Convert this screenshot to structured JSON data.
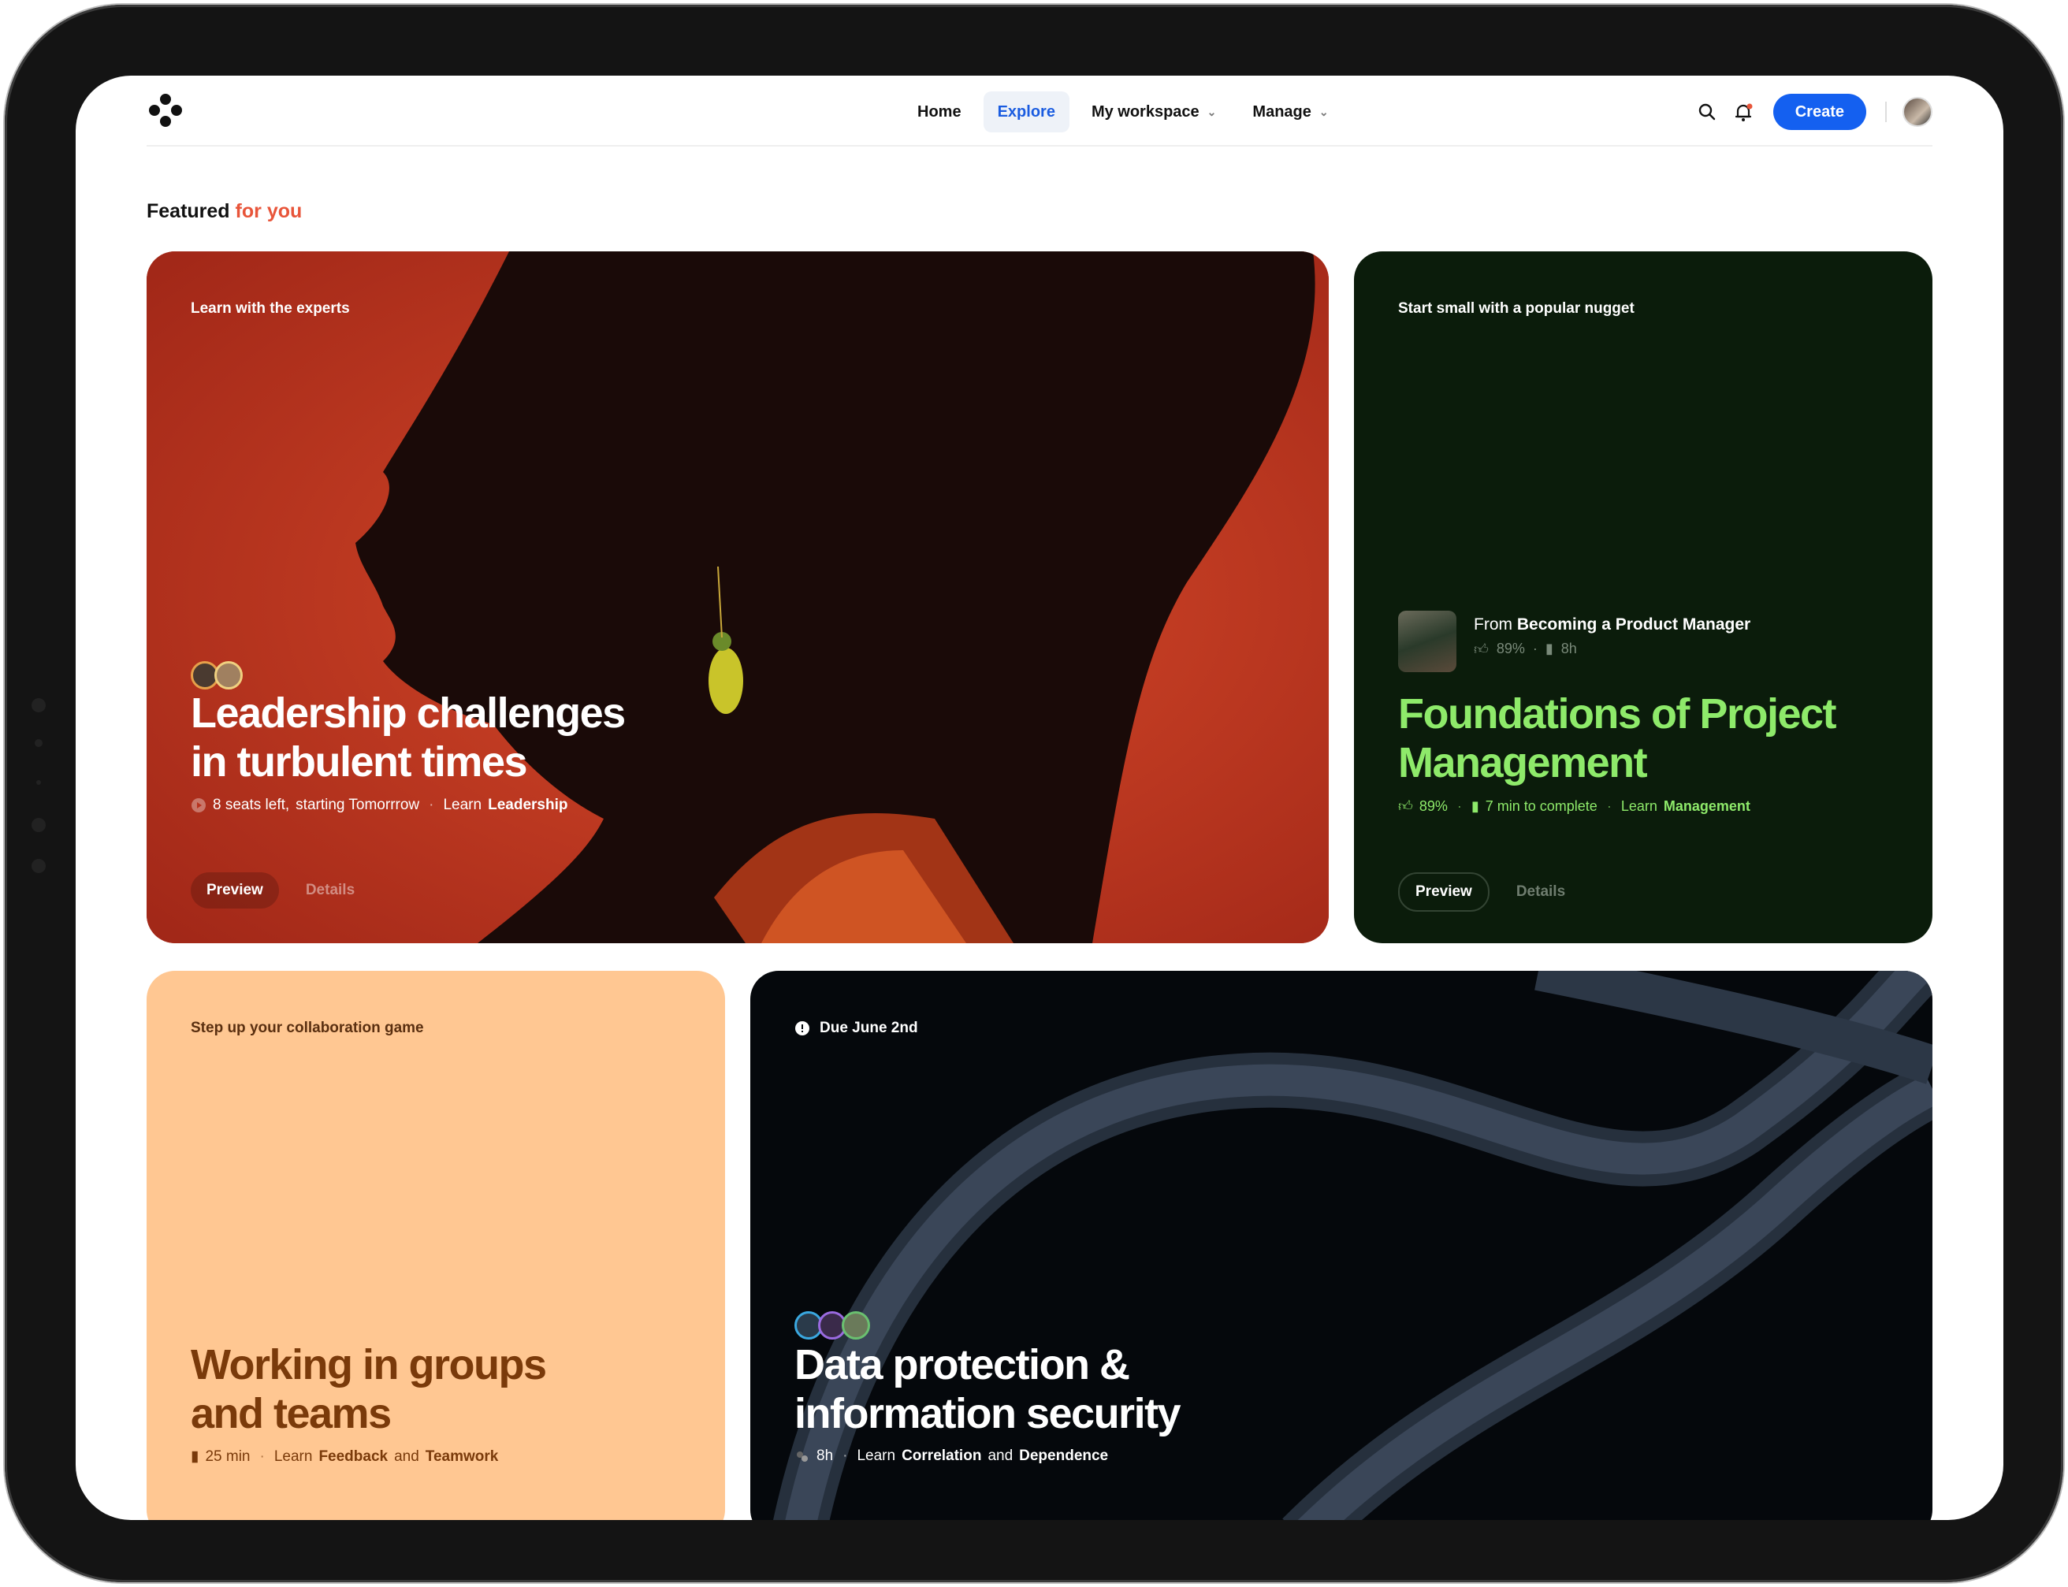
{
  "nav": {
    "items": [
      {
        "label": "Home",
        "active": false,
        "has_menu": false
      },
      {
        "label": "Explore",
        "active": true,
        "has_menu": false
      },
      {
        "label": "My workspace",
        "active": false,
        "has_menu": true
      },
      {
        "label": "Manage",
        "active": false,
        "has_menu": true
      }
    ],
    "create_label": "Create",
    "icons": [
      "search-icon",
      "bell-icon"
    ],
    "accent_color": "#1460f0"
  },
  "section": {
    "title_main": "Featured",
    "title_accent": "for you",
    "accent_color": "#e8553a"
  },
  "cards": {
    "leadership": {
      "eyebrow": "Learn with the experts",
      "title_line1": "Leadership challenges",
      "title_line2": "in turbulent times",
      "seats": "8 seats left,",
      "start": "starting Tomorrrow",
      "learn_prefix": "Learn",
      "topic": "Leadership",
      "preview": "Preview",
      "details": "Details",
      "bg_color": "#b8321e"
    },
    "project": {
      "eyebrow": "Start small with a popular nugget",
      "from_prefix": "From",
      "from_course": "Becoming a Product Manager",
      "from_rating": "89%",
      "from_sep": "·",
      "from_duration": "8h",
      "title_line1": "Foundations of Project",
      "title_line2": "Management",
      "rating": "89%",
      "duration": "7 min to complete",
      "learn_prefix": "Learn",
      "topic": "Management",
      "preview": "Preview",
      "details": "Details",
      "accent_color": "#8eea6a"
    },
    "groups": {
      "eyebrow": "Step up your collaboration game",
      "title_line1": "Working in groups",
      "title_line2": "and teams",
      "duration": "25 min",
      "learn_prefix": "Learn",
      "topic1": "Feedback",
      "conj": "and",
      "topic2": "Teamwork",
      "bg_color": "#ffc792"
    },
    "security": {
      "eyebrow": "Due June 2nd",
      "title_line1": "Data protection &",
      "title_line2": "information security",
      "duration": "8h",
      "learn_prefix": "Learn",
      "topic1": "Correlation",
      "conj": "and",
      "topic2": "Dependence"
    }
  }
}
